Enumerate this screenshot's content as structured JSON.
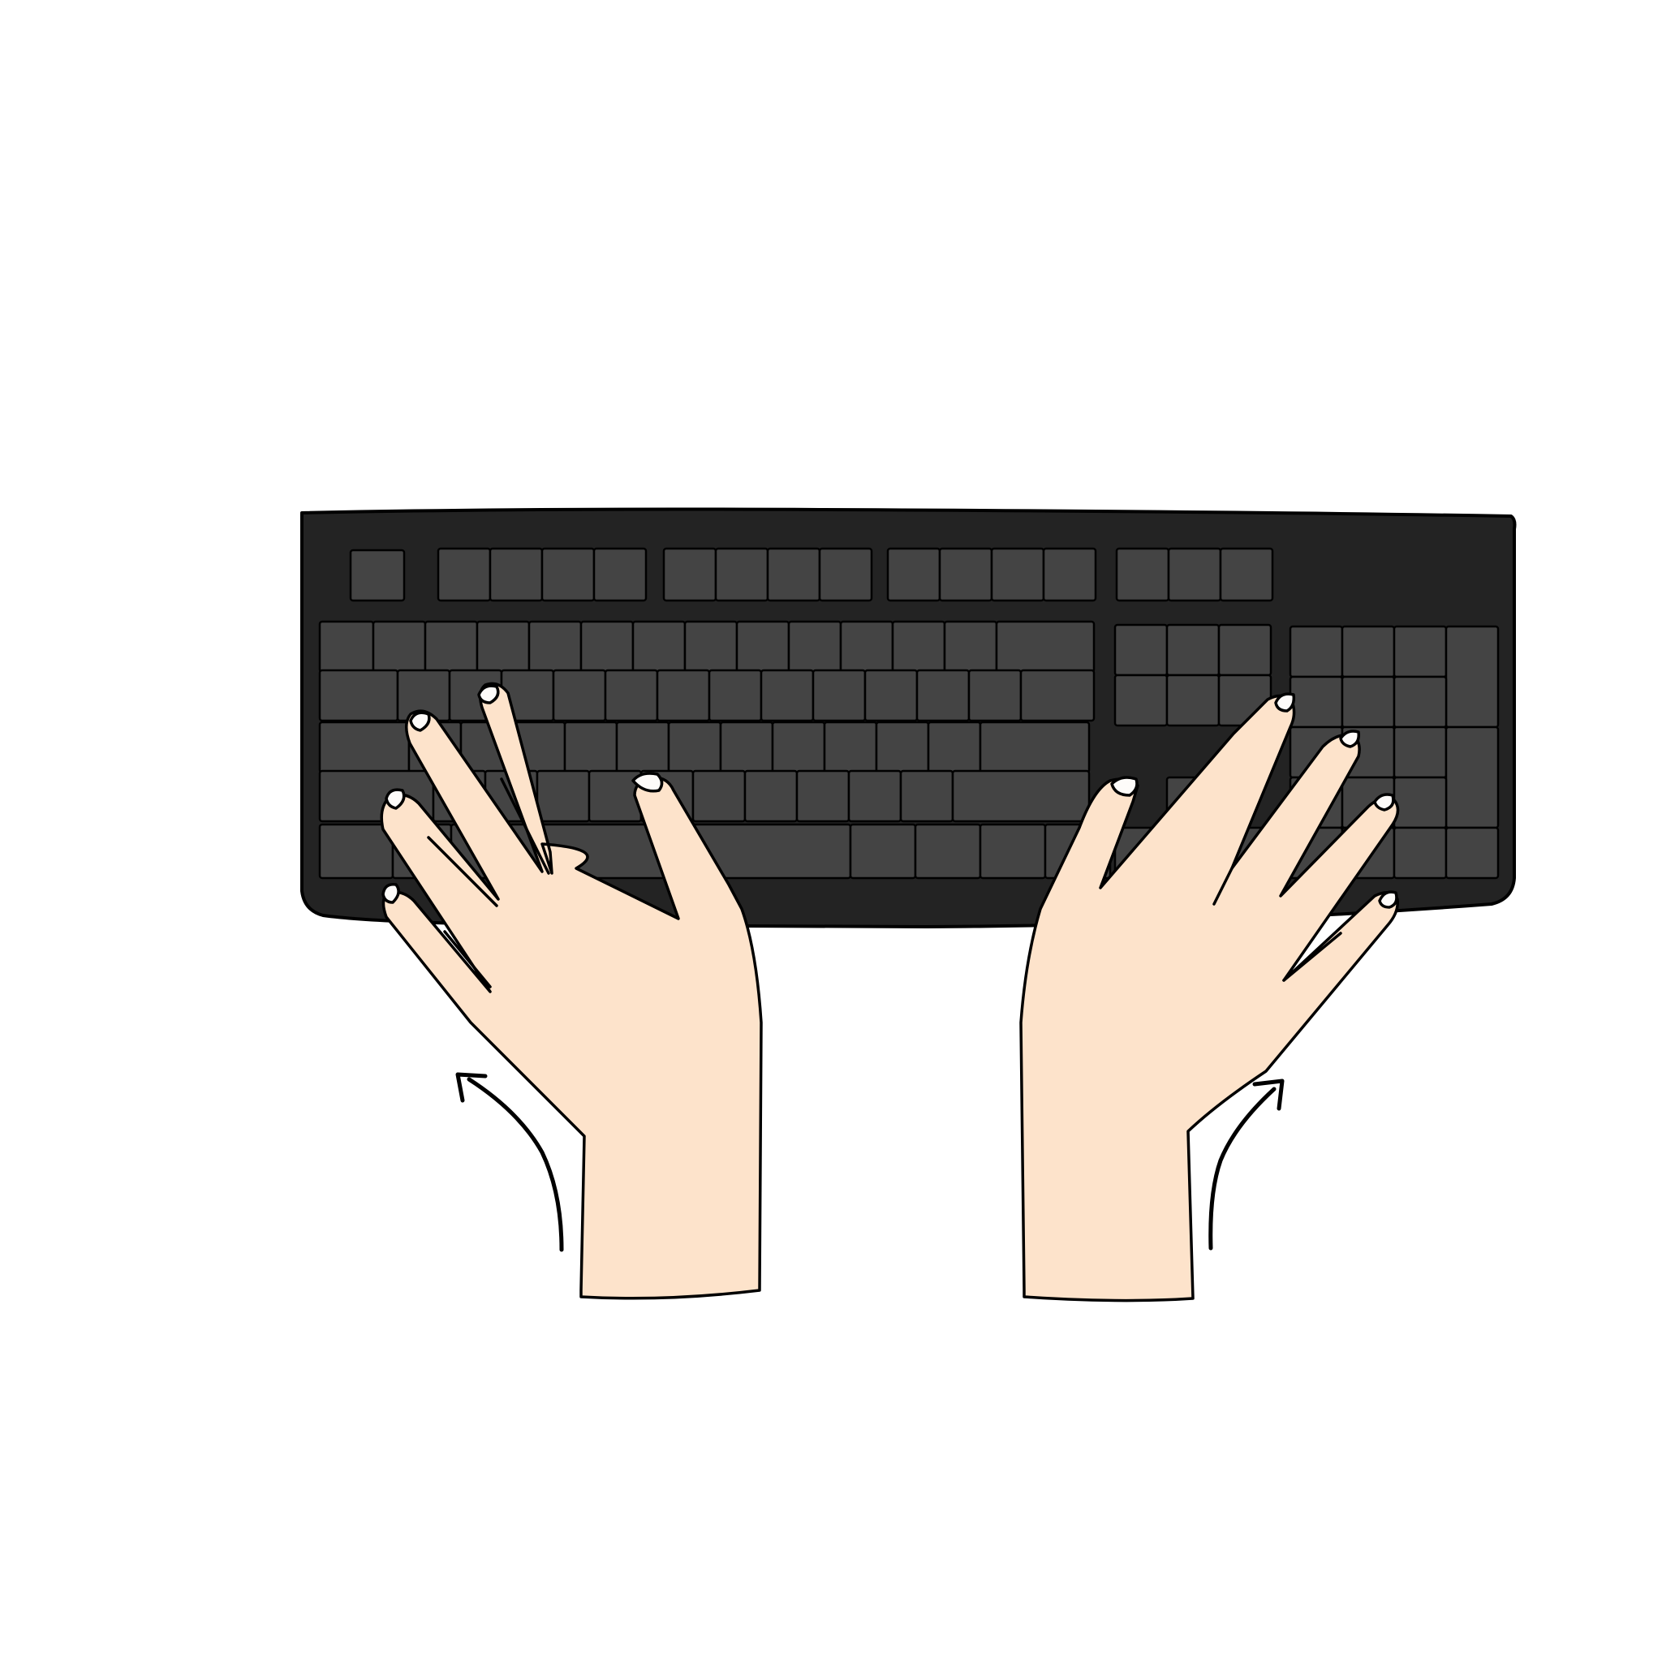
{
  "illustration": {
    "subject": "hands-on-keyboard",
    "background_color": "#ffffff",
    "keyboard": {
      "body_color": "#232323",
      "key_color": "#444444",
      "outline_color": "#000000"
    },
    "hands": {
      "skin_color": "#fde3cb",
      "nail_color": "#fdfbf9",
      "outline_color": "#000000"
    },
    "arrows": [
      {
        "icon": "curved-arrow-up-left-icon",
        "side": "left"
      },
      {
        "icon": "curved-arrow-up-right-icon",
        "side": "right"
      }
    ]
  }
}
